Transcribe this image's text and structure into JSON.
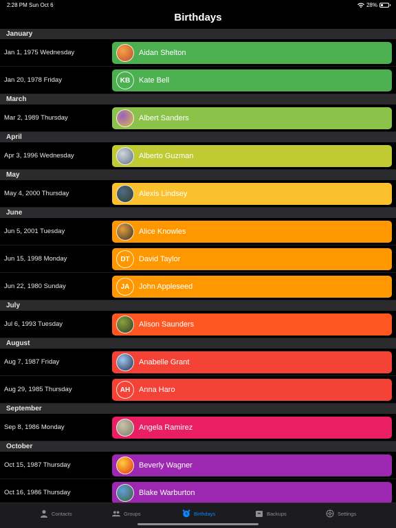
{
  "status": {
    "time": "2:28 PM",
    "date": "Sun Oct 6",
    "battery": "28%",
    "battery_level": 0.28
  },
  "title": "Birthdays",
  "sections": [
    {
      "header": "January",
      "rows": [
        {
          "date": "Jan 1, 1975 Wednesday",
          "name": "Aidan Shelton",
          "initials": "",
          "color": "#4cb050",
          "photo": [
            "#f5a04a",
            "#c0502a"
          ]
        },
        {
          "date": "Jan 20, 1978 Friday",
          "name": "Kate Bell",
          "initials": "KB",
          "color": "#4cb050",
          "photo": null
        }
      ]
    },
    {
      "header": "March",
      "rows": [
        {
          "date": "Mar 2, 1989 Thursday",
          "name": "Albert Sanders",
          "initials": "",
          "color": "#8bc34a",
          "photo": [
            "#9b5fc0",
            "#d8c040"
          ]
        }
      ]
    },
    {
      "header": "April",
      "rows": [
        {
          "date": "Apr 3, 1996 Wednesday",
          "name": "Alberto Guzman",
          "initials": "",
          "color": "#c0ca33",
          "photo": [
            "#d0d8e0",
            "#607080"
          ]
        }
      ]
    },
    {
      "header": "May",
      "rows": [
        {
          "date": "May 4, 2000 Thursday",
          "name": "Alexis Lindsey",
          "initials": "",
          "color": "#fbc02d",
          "photo": [
            "#506a80",
            "#304030"
          ]
        }
      ]
    },
    {
      "header": "June",
      "rows": [
        {
          "date": "Jun 5, 2001 Tuesday",
          "name": "Alice Knowles",
          "initials": "",
          "color": "#ff9800",
          "photo": [
            "#e0a040",
            "#403020"
          ]
        },
        {
          "date": "Jun 15, 1998 Monday",
          "name": "David Taylor",
          "initials": "DT",
          "color": "#ff9800",
          "photo": null
        },
        {
          "date": "Jun 22, 1980 Sunday",
          "name": "John Appleseed",
          "initials": "JA",
          "color": "#ff9800",
          "photo": null
        }
      ]
    },
    {
      "header": "July",
      "rows": [
        {
          "date": "Jul 6, 1993 Tuesday",
          "name": "Alison Saunders",
          "initials": "",
          "color": "#ff5722",
          "photo": [
            "#8aa040",
            "#304020"
          ]
        }
      ]
    },
    {
      "header": "August",
      "rows": [
        {
          "date": "Aug 7, 1987 Friday",
          "name": "Anabelle Grant",
          "initials": "",
          "color": "#f44336",
          "photo": [
            "#a0c8f0",
            "#203050"
          ]
        },
        {
          "date": "Aug 29, 1985 Thursday",
          "name": "Anna Haro",
          "initials": "AH",
          "color": "#f44336",
          "photo": null
        }
      ]
    },
    {
      "header": "September",
      "rows": [
        {
          "date": "Sep 8, 1986 Monday",
          "name": "Angela Ramirez",
          "initials": "",
          "color": "#e91e63",
          "photo": [
            "#d0c0b0",
            "#708060"
          ]
        }
      ]
    },
    {
      "header": "October",
      "rows": [
        {
          "date": "Oct 15, 1987 Thursday",
          "name": "Beverly Wagner",
          "initials": "",
          "color": "#9c27b0",
          "photo": [
            "#ffd040",
            "#e03010"
          ]
        },
        {
          "date": "Oct 16, 1986 Thursday",
          "name": "Blake Warburton",
          "initials": "",
          "color": "#9c27b0",
          "photo": [
            "#60a0e0",
            "#406030"
          ]
        }
      ]
    }
  ],
  "tabs": [
    {
      "label": "Contacts",
      "icon": "person-icon",
      "active": false
    },
    {
      "label": "Groups",
      "icon": "people-icon",
      "active": false
    },
    {
      "label": "Birthdays",
      "icon": "alarm-clock-icon",
      "active": true
    },
    {
      "label": "Backups",
      "icon": "archive-box-icon",
      "active": false
    },
    {
      "label": "Settings",
      "icon": "gear-icon",
      "active": false
    }
  ]
}
